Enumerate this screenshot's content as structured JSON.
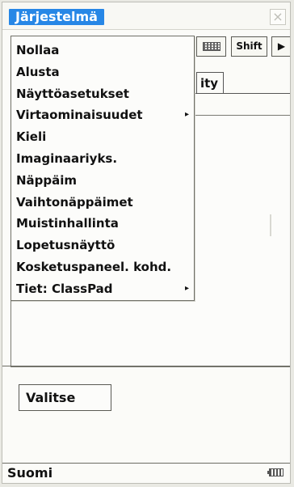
{
  "window": {
    "title": "Järjestelmä",
    "close_glyph": "×"
  },
  "toolbar": {
    "shift_label": "Shift",
    "arrow_glyph": "▶"
  },
  "background": {
    "tab_label_fragment": "ity",
    "select_label": "Valitse"
  },
  "menu": {
    "items": [
      {
        "label": "Nollaa",
        "submenu": false
      },
      {
        "label": "Alusta",
        "submenu": false
      },
      {
        "label": "Näyttöasetukset",
        "submenu": false
      },
      {
        "label": "Virtaominaisuudet",
        "submenu": true
      },
      {
        "label": "Kieli",
        "submenu": false
      },
      {
        "label": "Imaginaariyks.",
        "submenu": false
      },
      {
        "label": "Näppäim",
        "submenu": false
      },
      {
        "label": "Vaihtonäppäimet",
        "submenu": false
      },
      {
        "label": "Muistinhallinta",
        "submenu": false
      },
      {
        "label": "Lopetusnäyttö",
        "submenu": false
      },
      {
        "label": "Kosketuspaneel. kohd.",
        "submenu": false
      },
      {
        "label": "Tiet: ClassPad",
        "submenu": true
      }
    ],
    "submenu_glyph": "▸"
  },
  "status": {
    "language": "Suomi"
  },
  "icons": {
    "keyboard": "keyboard-icon",
    "battery": "battery-icon",
    "close": "close-icon",
    "arrow": "arrow-right-icon"
  }
}
